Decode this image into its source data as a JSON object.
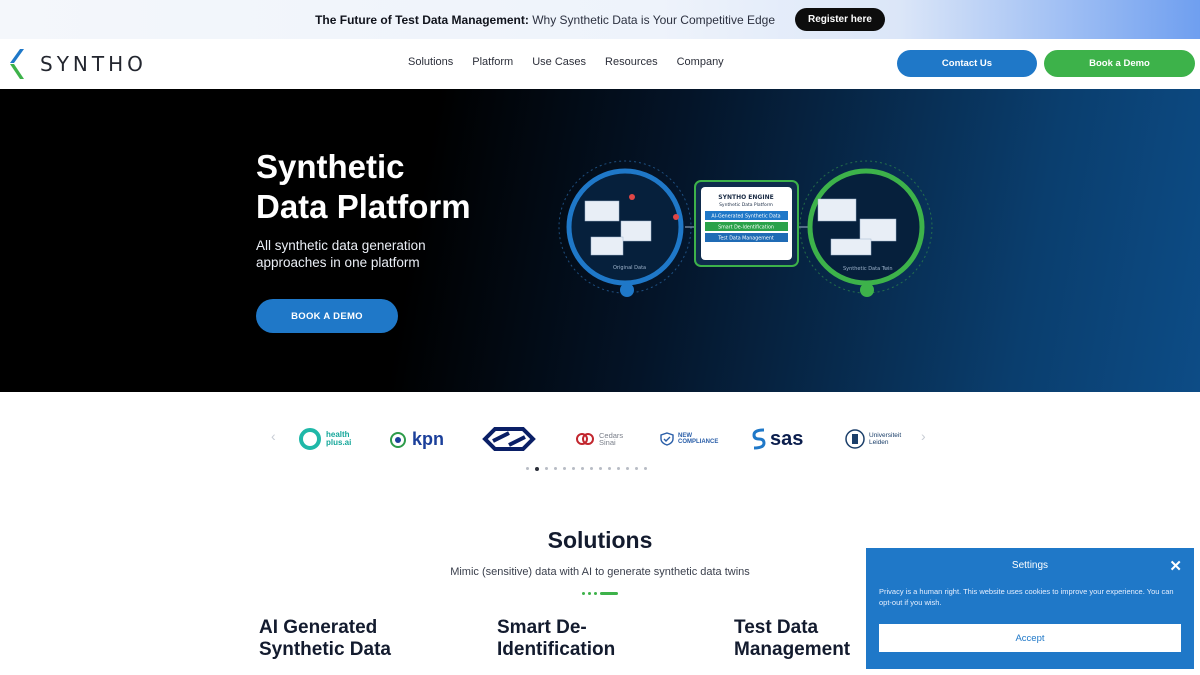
{
  "announcement": {
    "bold": "The Future of Test Data Management:",
    "text": " Why Synthetic Data is Your Competitive Edge",
    "cta": "Register here"
  },
  "brand": {
    "name": "SYNTHO",
    "accent_blue": "#1f78c8",
    "accent_green": "#3db24a"
  },
  "nav": {
    "items": [
      "Solutions",
      "Platform",
      "Use Cases",
      "Resources",
      "Company"
    ],
    "contact_label": "Contact Us",
    "demo_label": "Book a Demo"
  },
  "hero": {
    "title_line1": "Synthetic",
    "title_line2": "Data Platform",
    "subtitle_line1": "All synthetic data generation",
    "subtitle_line2": "approaches in one platform",
    "cta": "BOOK A DEMO",
    "illustration": {
      "engine_title": "SYNTHO ENGINE",
      "engine_sub": "Synthetic Data Platform",
      "engine_items": [
        "AI-Generated Synthetic Data",
        "Smart De-Identification",
        "Test Data Management"
      ],
      "left_label": "Original Data",
      "right_label": "Synthetic Data Twin"
    }
  },
  "logos": {
    "items": [
      {
        "name": "health-plus-ai",
        "text1": "health",
        "text2": "plus.ai"
      },
      {
        "name": "kpn",
        "text1": "kpn"
      },
      {
        "name": "ns",
        "text1": ""
      },
      {
        "name": "cedars-sinai",
        "text1": "Cedars",
        "text2": "Sinai"
      },
      {
        "name": "new-compliance",
        "text1": "NEW",
        "text2": "COMPLIANCE"
      },
      {
        "name": "sas",
        "text1": "sas"
      },
      {
        "name": "universiteit-leiden",
        "text1": "Universiteit",
        "text2": "Leiden"
      }
    ],
    "dots_count": 14,
    "active_dot": 1
  },
  "solutions": {
    "title": "Solutions",
    "subtitle": "Mimic (sensitive) data with AI to generate synthetic data twins",
    "cards": [
      {
        "line1": "AI Generated",
        "line2": "Synthetic Data"
      },
      {
        "line1": "Smart De-",
        "line2": "Identification"
      },
      {
        "line1": "Test Data",
        "line2": "Management"
      }
    ]
  },
  "cookie": {
    "title": "Settings",
    "text": "Privacy is a human right. This website uses cookies to improve your experience. You can opt-out if you wish.",
    "accept": "Accept"
  }
}
